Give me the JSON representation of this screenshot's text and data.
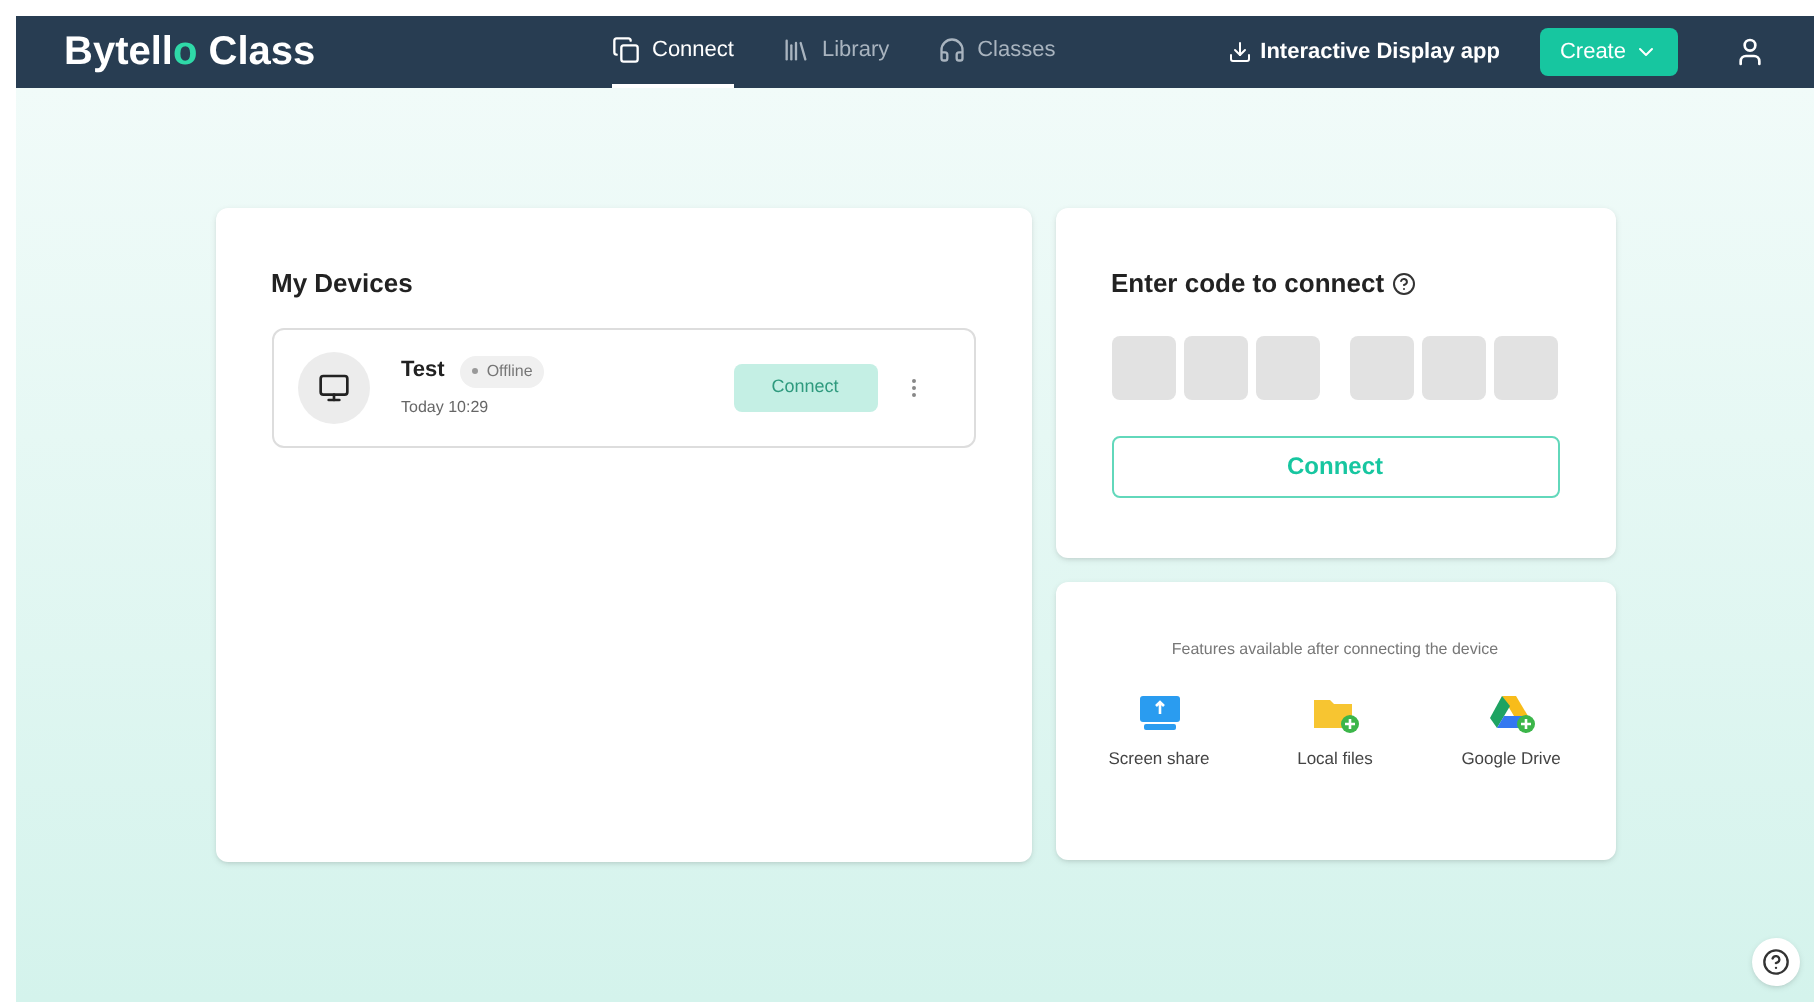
{
  "logo": [
    {
      "text": "Bytell",
      "accent": false
    },
    {
      "text": "o",
      "accent": true
    },
    {
      "text": " Class",
      "accent": false
    }
  ],
  "nav": [
    {
      "label": "Connect",
      "kind": "connect",
      "selected": true
    },
    {
      "label": "Library",
      "kind": "library",
      "selected": false
    },
    {
      "label": "Classes",
      "kind": "classes",
      "selected": false
    }
  ],
  "download_link": "Interactive Display app",
  "create_button": "Create",
  "devices": {
    "title": "My Devices",
    "items": [
      {
        "name": "Test",
        "status": "Offline",
        "time": "Today 10:29",
        "action": "Connect",
        "disabled": true
      }
    ]
  },
  "code": {
    "title": "Enter code to connect",
    "groups": [
      {
        "fields": [
          {
            "kind": "blank"
          },
          {
            "kind": "blank"
          },
          {
            "kind": "blank"
          }
        ]
      },
      {
        "fields": [
          {
            "kind": "blank"
          },
          {
            "kind": "blank"
          },
          {
            "kind": "blank"
          }
        ]
      }
    ],
    "button": "Connect"
  },
  "features": {
    "caption": "Features available after connecting the device",
    "items": [
      {
        "label": "Screen share",
        "kind": "screen"
      },
      {
        "label": "Local files",
        "kind": "folder"
      },
      {
        "label": "Google Drive",
        "kind": "drive"
      }
    ]
  }
}
